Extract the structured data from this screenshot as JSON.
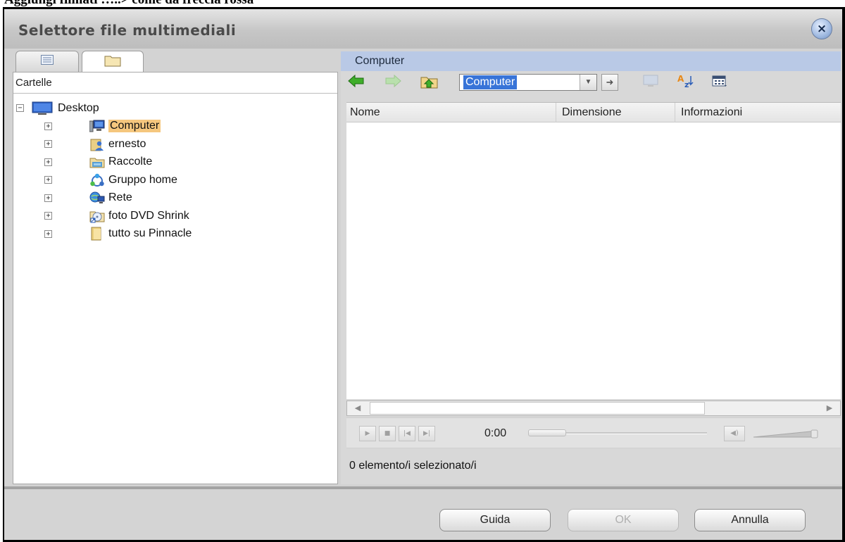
{
  "caption": {
    "text": "Aggiungi filmati …..> come da freccia rossa"
  },
  "window": {
    "title": "Selettore file multimediali",
    "close_glyph": "×"
  },
  "left_pane": {
    "tabs": [
      {
        "name": "list-view-tab",
        "icon": "list-icon"
      },
      {
        "name": "folders-tab",
        "icon": "folder-icon"
      }
    ],
    "header": "Cartelle",
    "tree": {
      "root": {
        "label": "Desktop",
        "icon": "desktop-icon",
        "expander": "−"
      },
      "children": [
        {
          "label": "Computer",
          "icon": "computer-icon",
          "selected": true,
          "expander": "+"
        },
        {
          "label": "ernesto",
          "icon": "user-folder-icon",
          "expander": "+"
        },
        {
          "label": "Raccolte",
          "icon": "libraries-icon",
          "expander": "+"
        },
        {
          "label": "Gruppo home",
          "icon": "homegroup-icon",
          "expander": "+"
        },
        {
          "label": "Rete",
          "icon": "network-icon",
          "expander": "+"
        },
        {
          "label": "foto DVD Shrink",
          "icon": "shortcut-folder-icon",
          "expander": "+"
        },
        {
          "label": "tutto su Pinnacle",
          "icon": "folder-icon",
          "expander": "+"
        }
      ]
    }
  },
  "right_pane": {
    "location": "Computer",
    "toolbar": {
      "address_value": "Computer",
      "icons": [
        "back-arrow-icon",
        "forward-arrow-icon",
        "up-folder-icon",
        "go-arrow-icon",
        "monitor-icon",
        "sort-az-icon",
        "view-mode-icon"
      ]
    },
    "columns": [
      "Nome",
      "Dimensione",
      "Informazioni"
    ],
    "player": {
      "time": "0:00"
    },
    "status": "0 elemento/i selezionato/i"
  },
  "buttons": {
    "help": "Guida",
    "ok": "OK",
    "cancel": "Annulla"
  },
  "colors": {
    "location_bar": "#b9c9e6",
    "selection_highlight": "#f5c77e",
    "address_selection": "#3874d8",
    "dialog_background": "#d3d3d3"
  }
}
